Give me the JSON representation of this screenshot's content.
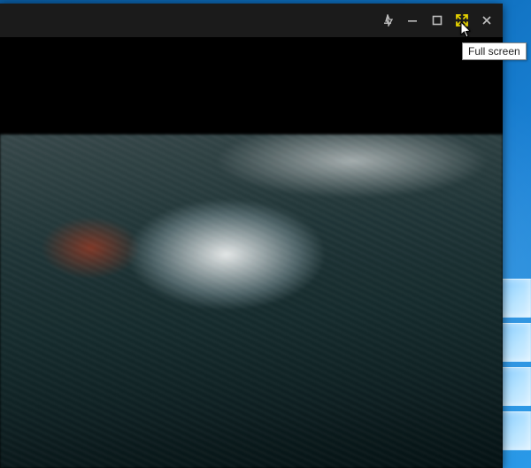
{
  "titlebar": {
    "icons": {
      "pin": "pin-icon",
      "minimize": "minimize-icon",
      "maximize": "maximize-icon",
      "fullscreen": "fullscreen-icon",
      "close": "close-icon"
    }
  },
  "tooltip": {
    "text": "Full screen"
  },
  "colors": {
    "accent": "#e6d200",
    "titlebar": "#1b1b1b"
  }
}
